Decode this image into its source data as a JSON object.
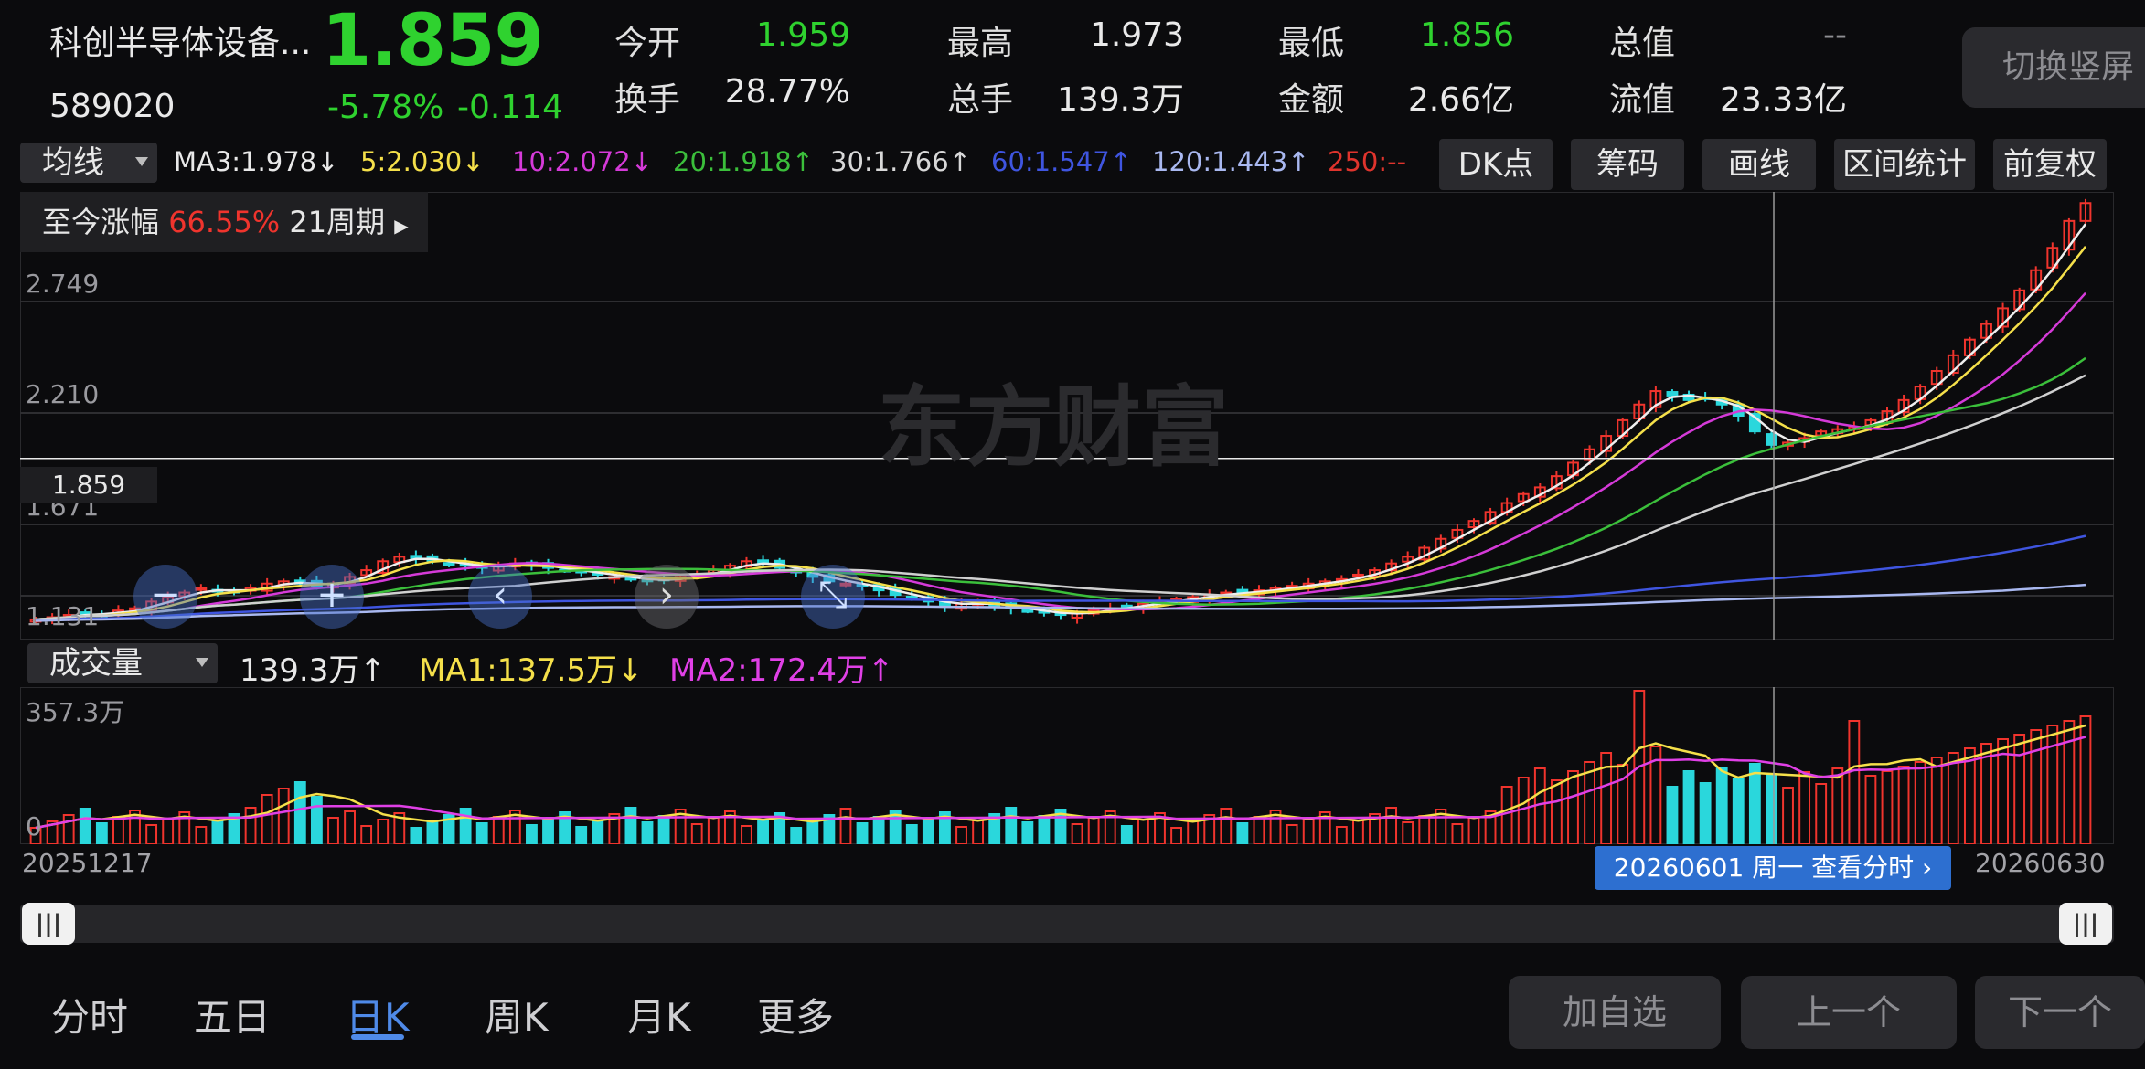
{
  "header": {
    "name": "科创半导体设备...",
    "code": "589020",
    "price": "1.859",
    "change_pct": "-5.78%",
    "change_val": "-0.114",
    "stats": [
      {
        "label": "今开",
        "value": "1.959",
        "color": "green"
      },
      {
        "label": "最高",
        "value": "1.973",
        "color": "white"
      },
      {
        "label": "最低",
        "value": "1.856",
        "color": "green"
      },
      {
        "label": "总值",
        "value": "--",
        "color": "gray"
      },
      {
        "label": "换手",
        "value": "28.77%",
        "color": "white"
      },
      {
        "label": "总手",
        "value": "139.3万",
        "color": "white"
      },
      {
        "label": "金额",
        "value": "2.66亿",
        "color": "white"
      },
      {
        "label": "流值",
        "value": "23.33亿",
        "color": "white"
      }
    ],
    "vertical_button": "切换竖屏"
  },
  "ma_bar": {
    "selector": "均线",
    "items": [
      {
        "text": "MA3:1.978↓",
        "color": "#e9e9e9"
      },
      {
        "text": "5:2.030↓",
        "color": "#f5e04a"
      },
      {
        "text": "10:2.072↓",
        "color": "#d53ad8"
      },
      {
        "text": "20:1.918↑",
        "color": "#3bbf3b"
      },
      {
        "text": "30:1.766↑",
        "color": "#d8d8d8"
      },
      {
        "text": "60:1.547↑",
        "color": "#3f55e0"
      },
      {
        "text": "120:1.443↑",
        "color": "#a9b8f0"
      },
      {
        "text": "250:--",
        "color": "#e0342d"
      }
    ],
    "buttons": [
      "DK点",
      "筹码",
      "画线",
      "区间统计",
      "前复权"
    ]
  },
  "period_stat": {
    "label": "至今涨幅",
    "value": "66.55%",
    "periods": "21周期"
  },
  "price_axis": [
    "2.749",
    "2.210",
    "1.671",
    "1.131"
  ],
  "current_price_tag": "1.859",
  "watermark": "东方财富",
  "volume_bar": {
    "selector": "成交量",
    "current": "139.3万↑",
    "ma1": "MA1:137.5万↓",
    "ma2": "MA2:172.4万↑",
    "axis_top": "357.3万",
    "axis_zero": "0"
  },
  "dates": {
    "start": "20251217",
    "end": "20260630",
    "tip": "20260601 周一 查看分时"
  },
  "tabs": [
    "分时",
    "五日",
    "日K",
    "周K",
    "月K",
    "更多"
  ],
  "bottom_buttons": [
    "加自选",
    "上一个",
    "下一个"
  ],
  "chart_data": {
    "type": "candlestick",
    "y_range": [
      1.131,
      3.0
    ],
    "closes": [
      1.14,
      1.15,
      1.16,
      1.17,
      1.16,
      1.18,
      1.19,
      1.22,
      1.24,
      1.26,
      1.28,
      1.27,
      1.26,
      1.28,
      1.3,
      1.31,
      1.3,
      1.29,
      1.3,
      1.33,
      1.36,
      1.4,
      1.42,
      1.41,
      1.4,
      1.39,
      1.38,
      1.37,
      1.38,
      1.39,
      1.38,
      1.37,
      1.36,
      1.35,
      1.34,
      1.33,
      1.32,
      1.31,
      1.32,
      1.33,
      1.34,
      1.36,
      1.38,
      1.4,
      1.39,
      1.37,
      1.35,
      1.33,
      1.31,
      1.3,
      1.29,
      1.27,
      1.25,
      1.24,
      1.22,
      1.2,
      1.21,
      1.22,
      1.2,
      1.19,
      1.18,
      1.17,
      1.16,
      1.17,
      1.18,
      1.19,
      1.2,
      1.21,
      1.22,
      1.23,
      1.24,
      1.25,
      1.26,
      1.26,
      1.27,
      1.28,
      1.29,
      1.3,
      1.31,
      1.32,
      1.34,
      1.36,
      1.39,
      1.42,
      1.46,
      1.5,
      1.54,
      1.58,
      1.62,
      1.66,
      1.7,
      1.73,
      1.78,
      1.84,
      1.9,
      1.96,
      2.03,
      2.1,
      2.16,
      2.14,
      2.12,
      2.13,
      2.1,
      2.05,
      1.98,
      1.92,
      1.93,
      1.95,
      1.98,
      1.99,
      2.0,
      2.03,
      2.07,
      2.12,
      2.18,
      2.25,
      2.32,
      2.39,
      2.46,
      2.53,
      2.61,
      2.7,
      2.8,
      2.92,
      3.0
    ]
  }
}
